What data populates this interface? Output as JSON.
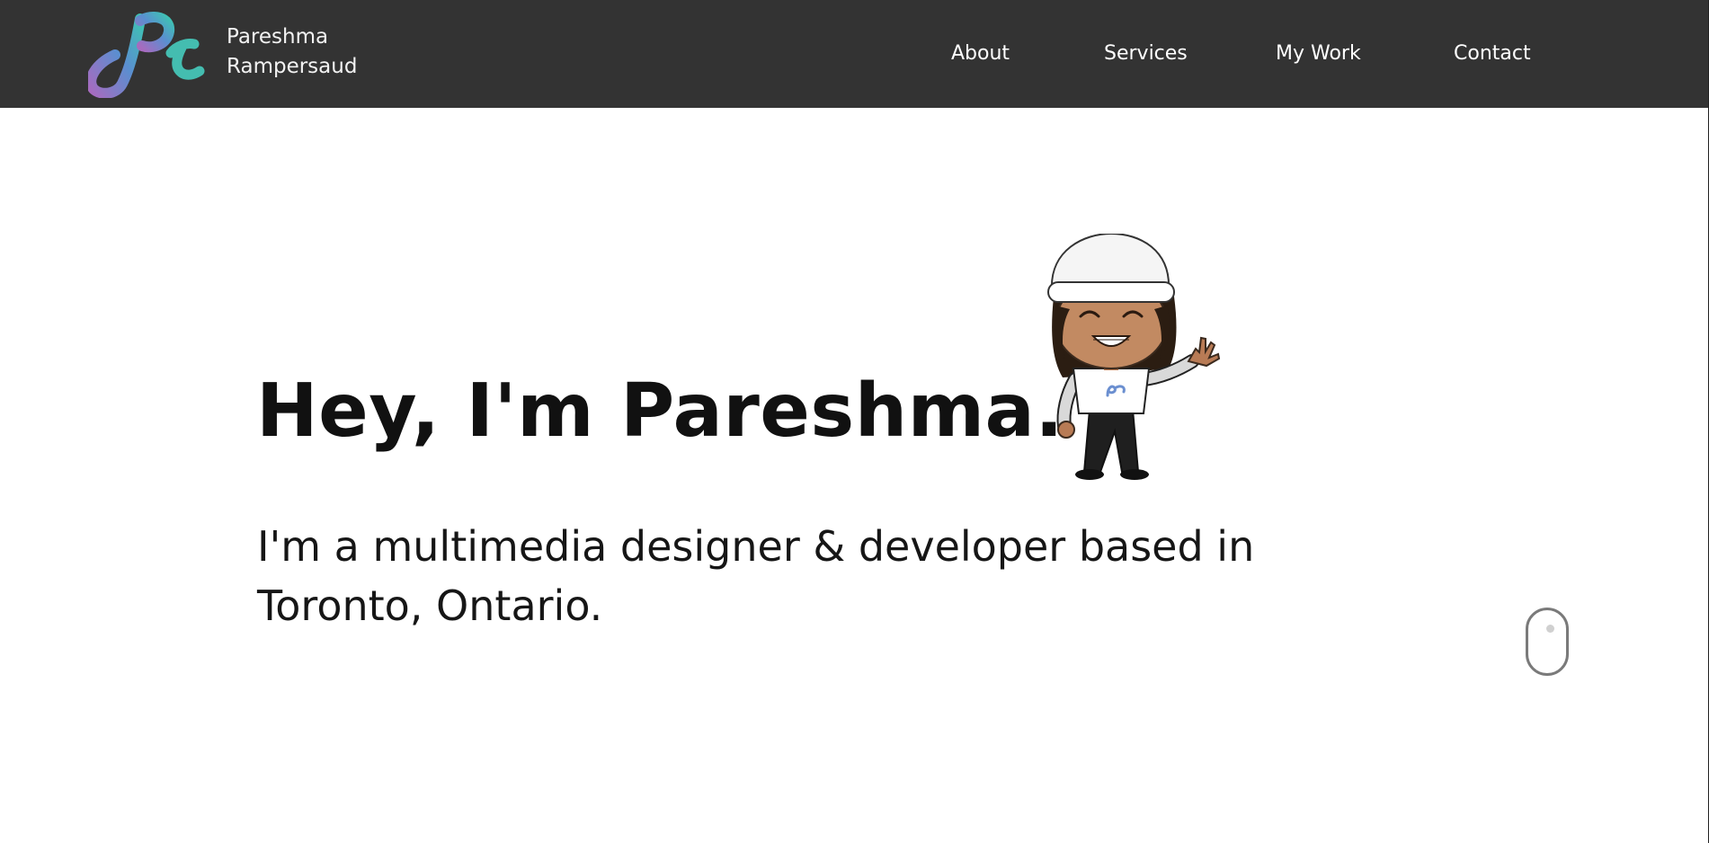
{
  "header": {
    "brand": {
      "logo_icon": "pr-monogram-logo",
      "first_name": "Pareshma",
      "last_name": "Rampersaud"
    },
    "nav": [
      {
        "label": "About"
      },
      {
        "label": "Services"
      },
      {
        "label": "My Work"
      },
      {
        "label": "Contact"
      }
    ]
  },
  "hero": {
    "title": "Hey, I'm Pareshma.",
    "subtitle": "I'm a multimedia designer & developer based in Toronto, Ontario.",
    "avatar_icon": "waving-avatar-illustration",
    "scroll_icon": "scroll-mouse-icon"
  },
  "colors": {
    "header_bg": "#333333",
    "logo_gradient_start": "#a76bbf",
    "logo_gradient_mid": "#5a8fd0",
    "logo_gradient_end": "#3ec3b3",
    "text": "#111111"
  }
}
